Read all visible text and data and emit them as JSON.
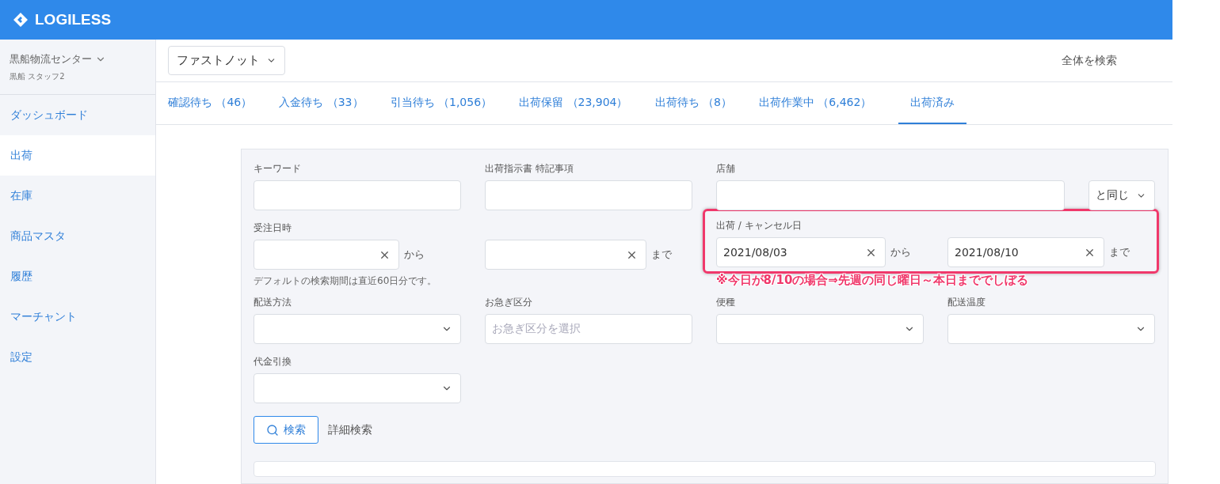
{
  "header": {
    "logo": "LOGILESS"
  },
  "sidebar": {
    "warehouse": "黒船物流センター",
    "user": "黒船 スタッフ2",
    "items": [
      {
        "label": "ダッシュボード",
        "selected": false
      },
      {
        "label": "出荷",
        "selected": true
      },
      {
        "label": "在庫",
        "selected": false
      },
      {
        "label": "商品マスタ",
        "selected": false
      },
      {
        "label": "履歴",
        "selected": false
      },
      {
        "label": "マーチャント",
        "selected": false
      },
      {
        "label": "設定",
        "selected": false
      }
    ]
  },
  "topbar": {
    "shop_select": "ファストノット",
    "search_all": "全体を検索"
  },
  "tabs": [
    {
      "label": "確認待ち （46）",
      "selected": false
    },
    {
      "label": "入金待ち （33）",
      "selected": false
    },
    {
      "label": "引当待ち （1,056）",
      "selected": false
    },
    {
      "label": "出荷保留 （23,904）",
      "selected": false
    },
    {
      "label": "出荷待ち （8）",
      "selected": false
    },
    {
      "label": "出荷作業中 （6,462）",
      "selected": false
    },
    {
      "label": "出荷済み",
      "selected": true
    }
  ],
  "filters": {
    "keyword": {
      "label": "キーワード"
    },
    "notes": {
      "label": "出荷指示書 特記事項"
    },
    "store": {
      "label": "店舗",
      "match": "と同じ"
    },
    "order_date": {
      "label": "受注日時",
      "from_suffix": "から",
      "to_suffix": "まで",
      "hint": "デフォルトの検索期間は直近60日分です。"
    },
    "ship_date": {
      "label": "出荷 / キャンセル日",
      "from": "2021/08/03",
      "from_suffix": "から",
      "to": "2021/08/10",
      "to_suffix": "まで"
    },
    "selects": [
      {
        "kind": "select",
        "label": "配送方法"
      },
      {
        "kind": "text",
        "label": "お急ぎ区分",
        "placeholder": "お急ぎ区分を選択"
      },
      {
        "kind": "select",
        "label": "便種"
      },
      {
        "kind": "select",
        "label": "配送温度"
      },
      {
        "kind": "select",
        "label": "代金引換"
      }
    ]
  },
  "search_button": "検索",
  "advanced_search": "詳細検索",
  "annotation": {
    "note": "※今日が8/10の場合⇒先週の同じ曜日～本日まででしぼる"
  }
}
